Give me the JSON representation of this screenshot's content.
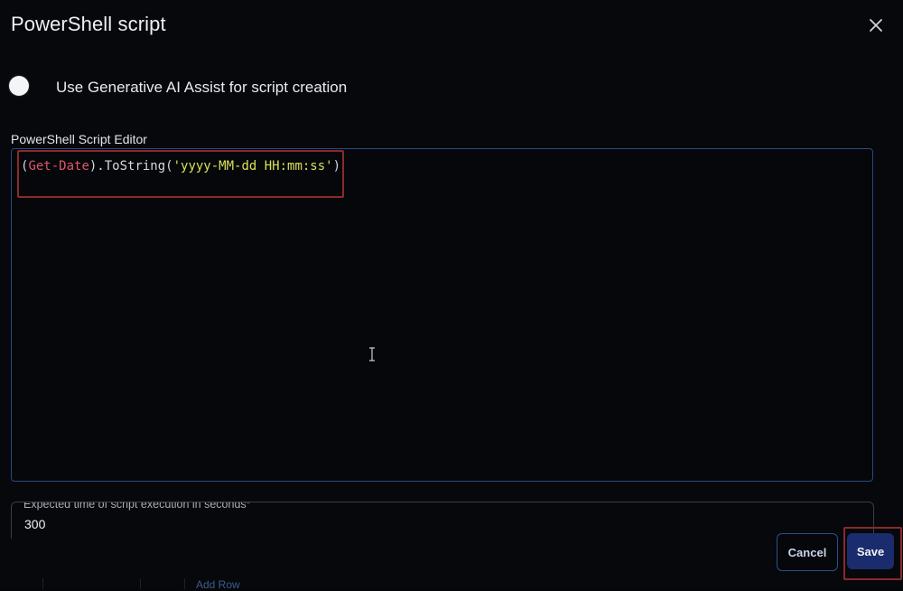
{
  "dialog": {
    "title": "PowerShell script"
  },
  "ai_toggle": {
    "label": "Use Generative AI Assist for script creation",
    "enabled": false
  },
  "editor": {
    "label": "PowerShell Script Editor",
    "code": {
      "open_paren": "(",
      "command": "Get-Date",
      "middle": ").ToString(",
      "string": "'yyyy-MM-dd HH:mm:ss'",
      "close_paren": ")"
    }
  },
  "execution_time": {
    "label": "Expected time of script execution in seconds",
    "required_marker": "*",
    "value": "300"
  },
  "footer": {
    "add_row_label": "Add Row",
    "cancel_label": "Cancel",
    "save_label": "Save"
  },
  "icons": {
    "close": "close-icon",
    "text_cursor": "text-cursor-icon"
  },
  "colors": {
    "background": "#06080b",
    "editor_border": "#2a4a82",
    "save_button": "#1a2c6e",
    "highlight": "#8a2a2a",
    "token_command": "#e0566a",
    "token_string": "#d9e05a"
  }
}
